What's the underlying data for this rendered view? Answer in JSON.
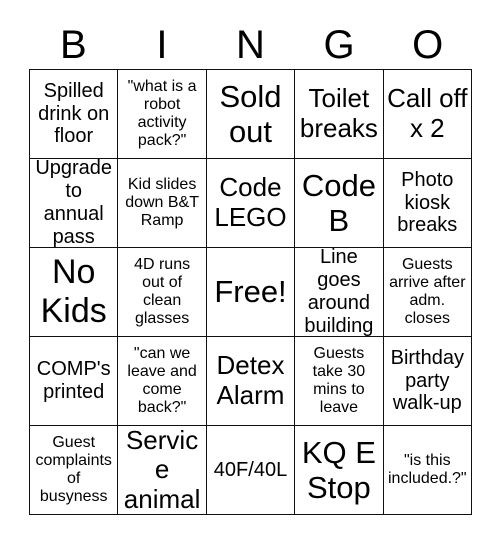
{
  "title": "BINGO",
  "header": {
    "letters": [
      "B",
      "I",
      "N",
      "G",
      "O"
    ]
  },
  "grid": {
    "columns": 5,
    "rows": 5,
    "border_color": "#111111",
    "background_color": "#ffffff",
    "text_color": "#000000"
  },
  "cells": [
    {
      "text": "Spilled drink on floor",
      "size": "m",
      "free": false
    },
    {
      "text": "\"what is a robot activity pack?\"",
      "size": "s",
      "free": false
    },
    {
      "text": "Sold out",
      "size": "xl",
      "free": false
    },
    {
      "text": "Toilet breaks",
      "size": "l",
      "free": false
    },
    {
      "text": "Call off x 2",
      "size": "l",
      "free": false
    },
    {
      "text": "Upgrade to annual pass",
      "size": "m",
      "free": false
    },
    {
      "text": "Kid slides down B&T Ramp",
      "size": "s",
      "free": false
    },
    {
      "text": "Code LEGO",
      "size": "l",
      "free": false
    },
    {
      "text": "Code B",
      "size": "xl",
      "free": false
    },
    {
      "text": "Photo kiosk breaks",
      "size": "m",
      "free": false
    },
    {
      "text": "No Kids",
      "size": "xxl",
      "free": false
    },
    {
      "text": "4D runs out of clean glasses",
      "size": "s",
      "free": false
    },
    {
      "text": "Free!",
      "size": "xl",
      "free": true
    },
    {
      "text": "Line goes around building",
      "size": "m",
      "free": false
    },
    {
      "text": "Guests arrive after adm. closes",
      "size": "s",
      "free": false
    },
    {
      "text": "COMP's printed",
      "size": "m",
      "free": false
    },
    {
      "text": "\"can we leave and come back?\"",
      "size": "s",
      "free": false
    },
    {
      "text": "Detex Alarm",
      "size": "l",
      "free": false
    },
    {
      "text": "Guests take 30 mins to leave",
      "size": "s",
      "free": false
    },
    {
      "text": "Birthday party walk-up",
      "size": "m",
      "free": false
    },
    {
      "text": "Guest complaints of busyness",
      "size": "s",
      "free": false
    },
    {
      "text": "Service animal",
      "size": "l",
      "free": false
    },
    {
      "text": "40F/40L",
      "size": "m",
      "free": false
    },
    {
      "text": "KQ E Stop",
      "size": "xl",
      "free": false
    },
    {
      "text": "\"is this included.?\"",
      "size": "s",
      "free": false
    }
  ]
}
